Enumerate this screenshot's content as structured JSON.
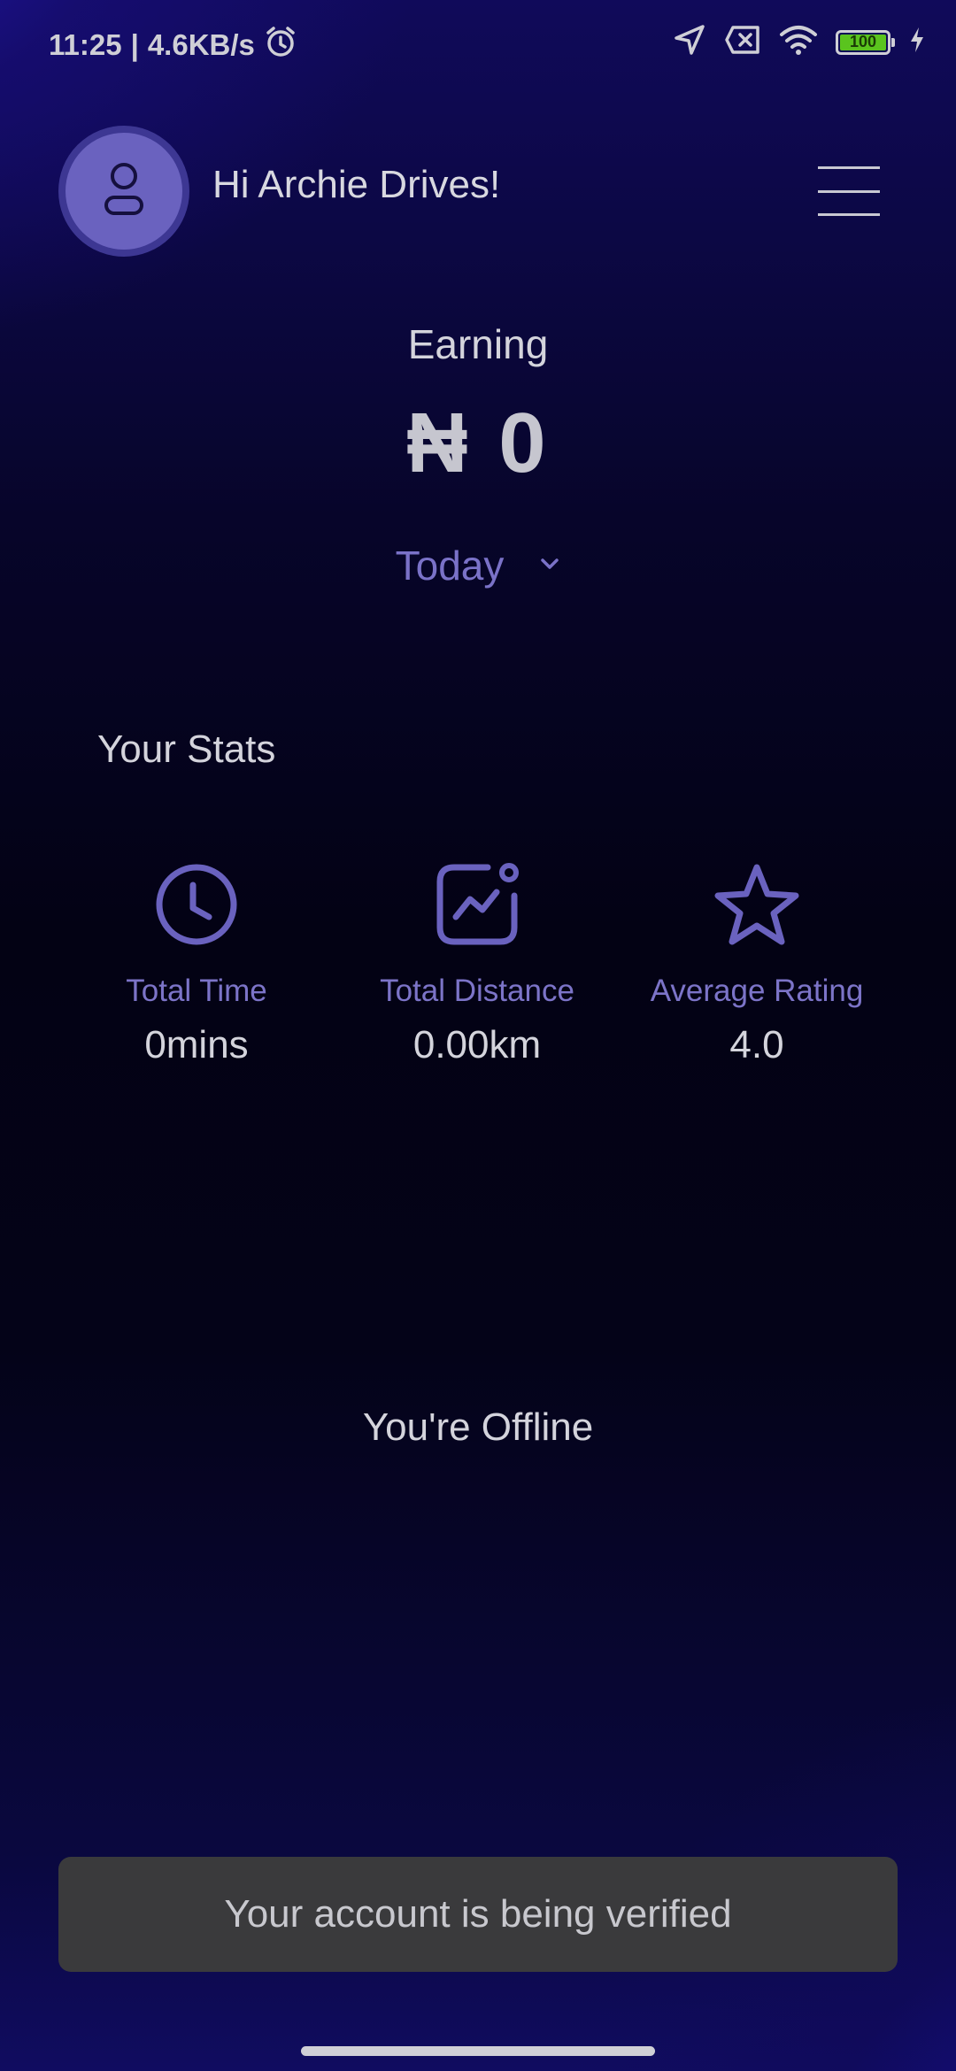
{
  "status_bar": {
    "time": "11:25",
    "separator": "|",
    "network_speed": "4.6KB/s",
    "icons": [
      "alarm-icon",
      "location-icon",
      "sim-error-icon",
      "wifi-icon",
      "battery-icon",
      "charging-icon"
    ],
    "battery_level": "100",
    "battery_fraction": 1.0
  },
  "header": {
    "avatar_icon": "user-icon",
    "greeting": "Hi Archie Drives!",
    "menu_icon": "hamburger-menu-icon"
  },
  "earnings": {
    "label": "Earning",
    "value": "₦ 0",
    "period": "Today",
    "period_icon": "chevron-down-icon"
  },
  "stats": {
    "title": "Your Stats",
    "items": [
      {
        "icon": "clock-icon",
        "label": "Total Time",
        "value": "0mins"
      },
      {
        "icon": "chart-icon",
        "label": "Total Distance",
        "value": "0.00km"
      },
      {
        "icon": "star-icon",
        "label": "Average Rating",
        "value": "4.0"
      }
    ]
  },
  "status_message": "You're Offline",
  "toast": "Your account is being verified",
  "colors": {
    "accent": "#6a62bf",
    "accent_text": "#7a72c8",
    "battery_fill": "#5ac41e",
    "toast_bg": "#3a3a3c"
  }
}
